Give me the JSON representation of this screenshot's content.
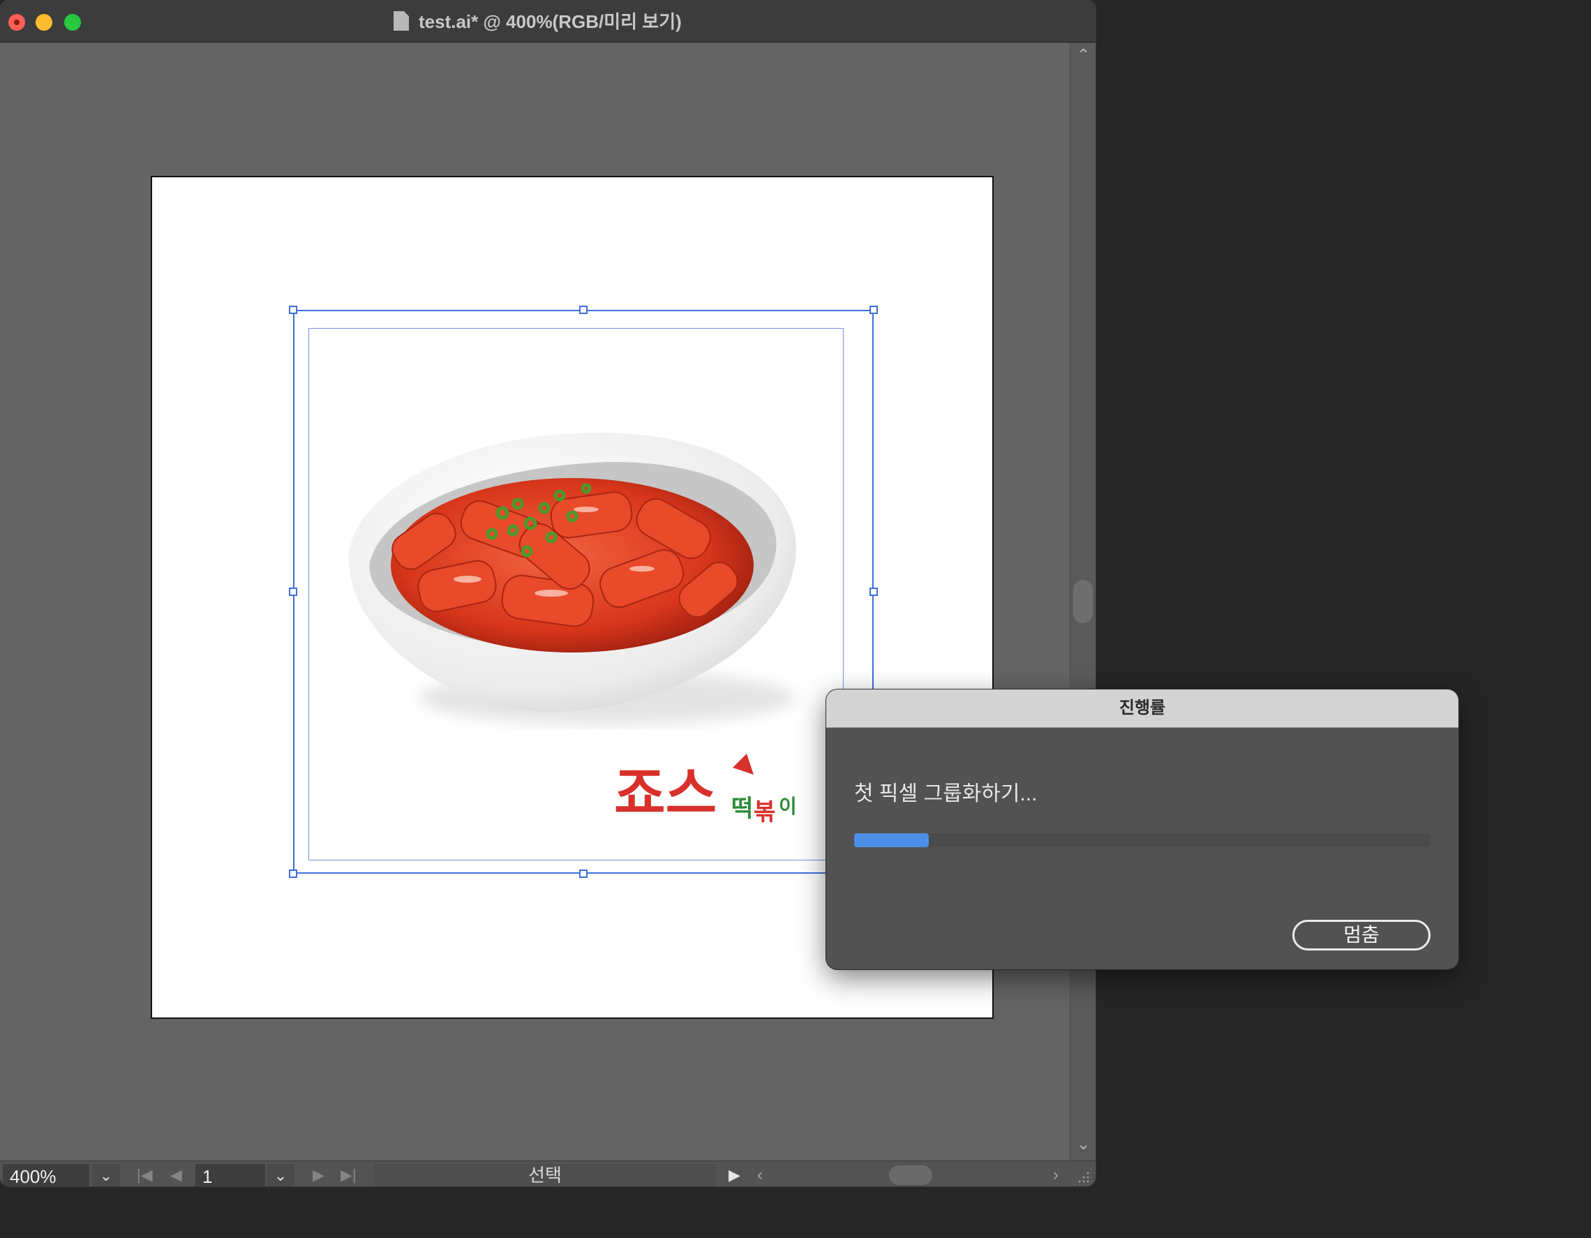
{
  "window": {
    "title": "test.ai* @ 400%(RGB/미리 보기)"
  },
  "artboard": {
    "logo_text": "죠스떡볶이"
  },
  "statusbar": {
    "zoom": "400%",
    "page_number": "1",
    "status_text": "선택"
  },
  "progress_dialog": {
    "title": "진행률",
    "message": "첫 픽셀 그룹화하기...",
    "progress": 0.13,
    "stop_label": "멈춤",
    "accent_color": "#4d8fe6"
  },
  "icons": {
    "window_controls": [
      "close-icon",
      "minimize-icon",
      "maximize-icon"
    ],
    "document": "document-icon",
    "scroll_up": "chevron-up-icon",
    "scroll_down": "chevron-down-icon",
    "zoom_dropdown": "chevron-down-icon",
    "first_page": "first-page-icon",
    "previous_page": "previous-page-icon",
    "next_page": "next-page-icon",
    "last_page": "last-page-icon",
    "play": "play-icon",
    "scroll_left": "chevron-left-icon",
    "scroll_right": "chevron-right-icon"
  }
}
